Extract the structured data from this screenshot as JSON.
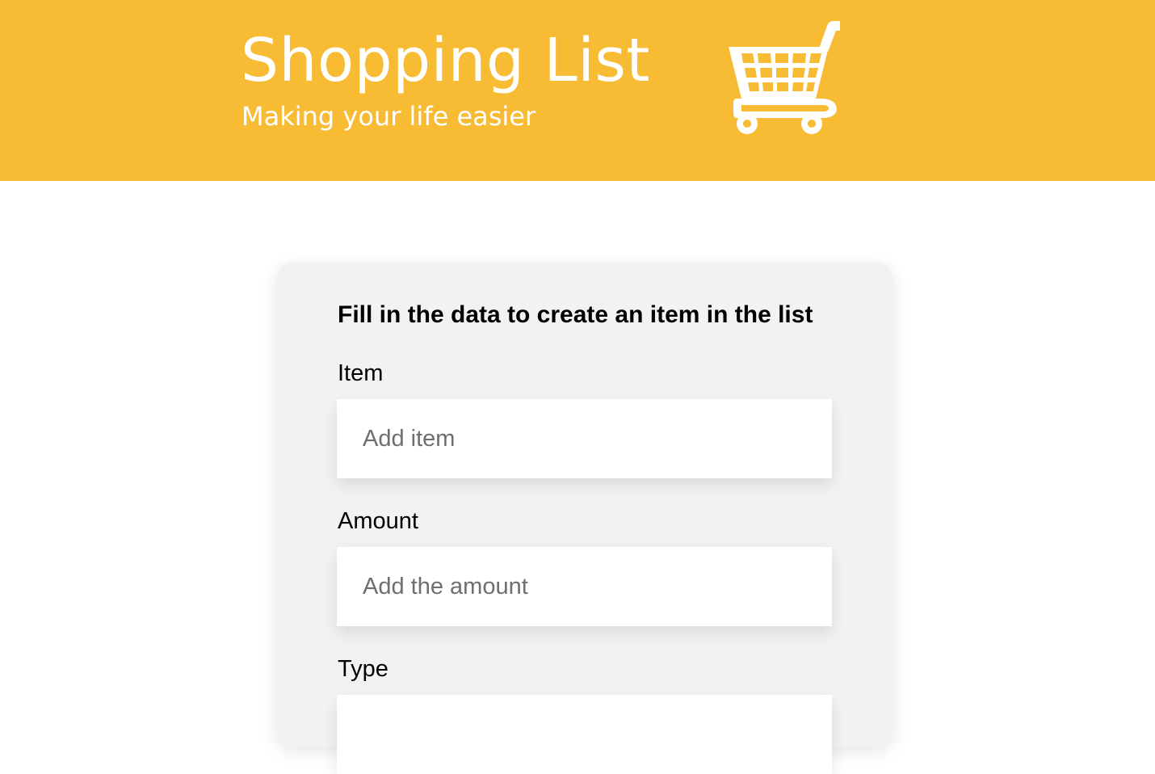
{
  "header": {
    "title": "Shopping List",
    "subtitle": "Making your life easier",
    "icon": "shopping-cart-icon",
    "background_color": "#F7BB34",
    "text_color": "#FFFFFF"
  },
  "form": {
    "heading": "Fill in the data to create an item in the list",
    "background_color": "#F2F2F2",
    "fields": [
      {
        "label": "Item",
        "placeholder": "Add item",
        "value": ""
      },
      {
        "label": "Amount",
        "placeholder": "Add the amount",
        "value": ""
      },
      {
        "label": "Type",
        "placeholder": "",
        "value": ""
      }
    ]
  }
}
